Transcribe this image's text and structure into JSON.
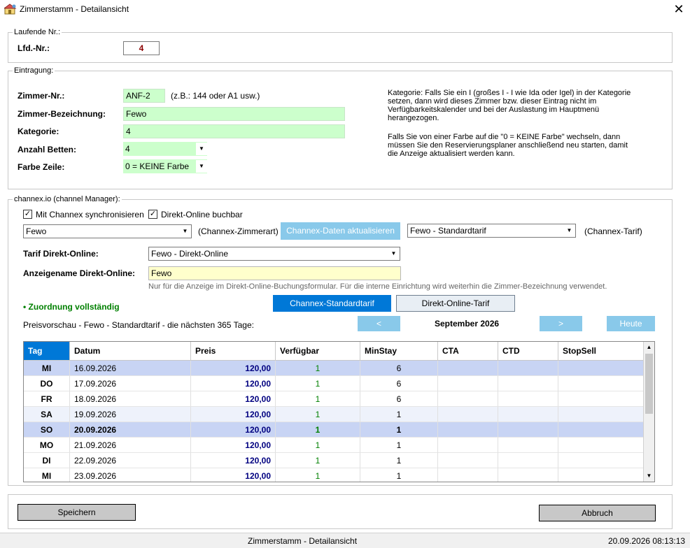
{
  "window": {
    "title": "Zimmerstamm - Detailansicht",
    "close_glyph": "✕"
  },
  "laufende": {
    "group_label": "Laufende Nr.:",
    "lfd_label": "Lfd.-Nr.:",
    "lfd_value": "4"
  },
  "eintragung": {
    "group_label": "Eintragung:",
    "zimmer_nr_label": "Zimmer-Nr.:",
    "zimmer_nr_value": "ANF-2",
    "zimmer_nr_hint": "(z.B.: 144 oder A1 usw.)",
    "bezeichnung_label": "Zimmer-Bezeichnung:",
    "bezeichnung_value": "Fewo",
    "kategorie_label": "Kategorie:",
    "kategorie_value": "4",
    "betten_label": "Anzahl Betten:",
    "betten_value": "4",
    "farbe_label": "Farbe Zeile:",
    "farbe_value": "0 = KEINE Farbe",
    "info_1": "Kategorie: Falls Sie ein I (großes I - I wie Ida oder Igel) in der Kategorie setzen, dann wird dieses Zimmer bzw. dieser Eintrag nicht im Verfügbarkeitskalender und bei der Auslastung im Hauptmenü herangezogen.",
    "info_2": "Falls Sie von einer Farbe auf die \"0 = KEINE Farbe\" wechseln, dann müssen Sie den Reservierungsplaner anschließend neu starten, damit die Anzeige aktualisiert werden kann."
  },
  "channex": {
    "group_label": "channex.io (channel Manager):",
    "sync_label": "Mit Channex synchronisieren",
    "sync_checked": "✓",
    "direkt_label": "Direkt-Online buchbar",
    "direkt_checked": "✓",
    "zimmerart_value": "Fewo",
    "zimmerart_caption": "(Channex-Zimmerart)",
    "refresh_button": "Channex-Daten aktualisieren",
    "tarif_value": "Fewo - Standardtarif",
    "tarif_caption": "(Channex-Tarif)",
    "tarif_direkt_label": "Tarif Direkt-Online:",
    "tarif_direkt_value": "Fewo - Direkt-Online",
    "anzeigename_label": "Anzeigename Direkt-Online:",
    "anzeigename_value": "Fewo",
    "anzeigename_hint": "Nur für die Anzeige im Direkt-Online-Buchungsformular. Für die interne Einrichtung wird weiterhin die Zimmer-Bezeichnung verwendet.",
    "zuordnung_status": "• Zuordnung vollständig",
    "tab_standard": "Channex-Standardtarif",
    "tab_direkt": "Direkt-Online-Tarif",
    "preview_label": "Preisvorschau - Fewo - Standardtarif - die nächsten 365 Tage:",
    "prev_button": "<",
    "month_label": "September 2026",
    "next_button": ">",
    "today_button": "Heute"
  },
  "grid": {
    "columns": [
      "Tag",
      "Datum",
      "Preis",
      "Verfügbar",
      "MinStay",
      "CTA",
      "CTD",
      "StopSell"
    ],
    "rows": [
      {
        "tag": "MI",
        "datum": "16.09.2026",
        "preis": "120,00",
        "verfuegbar": "1",
        "minstay": "6",
        "cta": "",
        "ctd": "",
        "stopsell": "",
        "style": "selected"
      },
      {
        "tag": "DO",
        "datum": "17.09.2026",
        "preis": "120,00",
        "verfuegbar": "1",
        "minstay": "6",
        "cta": "",
        "ctd": "",
        "stopsell": "",
        "style": "normal"
      },
      {
        "tag": "FR",
        "datum": "18.09.2026",
        "preis": "120,00",
        "verfuegbar": "1",
        "minstay": "6",
        "cta": "",
        "ctd": "",
        "stopsell": "",
        "style": "normal"
      },
      {
        "tag": "SA",
        "datum": "19.09.2026",
        "preis": "120,00",
        "verfuegbar": "1",
        "minstay": "1",
        "cta": "",
        "ctd": "",
        "stopsell": "",
        "style": "weekend"
      },
      {
        "tag": "SO",
        "datum": "20.09.2026",
        "preis": "120,00",
        "verfuegbar": "1",
        "minstay": "1",
        "cta": "",
        "ctd": "",
        "stopsell": "",
        "style": "today"
      },
      {
        "tag": "MO",
        "datum": "21.09.2026",
        "preis": "120,00",
        "verfuegbar": "1",
        "minstay": "1",
        "cta": "",
        "ctd": "",
        "stopsell": "",
        "style": "normal"
      },
      {
        "tag": "DI",
        "datum": "22.09.2026",
        "preis": "120,00",
        "verfuegbar": "1",
        "minstay": "1",
        "cta": "",
        "ctd": "",
        "stopsell": "",
        "style": "normal"
      },
      {
        "tag": "MI",
        "datum": "23.09.2026",
        "preis": "120,00",
        "verfuegbar": "1",
        "minstay": "1",
        "cta": "",
        "ctd": "",
        "stopsell": "",
        "style": "normal"
      }
    ]
  },
  "footer": {
    "save_button": "Speichern",
    "cancel_button": "Abbruch"
  },
  "statusbar": {
    "center_text": "Zimmerstamm - Detailansicht",
    "datetime": "20.09.2026 08:13:13"
  },
  "colors": {
    "selected_row": "#c8d4f4",
    "weekend_row": "#eef2fb",
    "price_text": "#000080",
    "available_text": "#008000",
    "status_green": "#008000",
    "lfd_red": "#8b0000"
  }
}
